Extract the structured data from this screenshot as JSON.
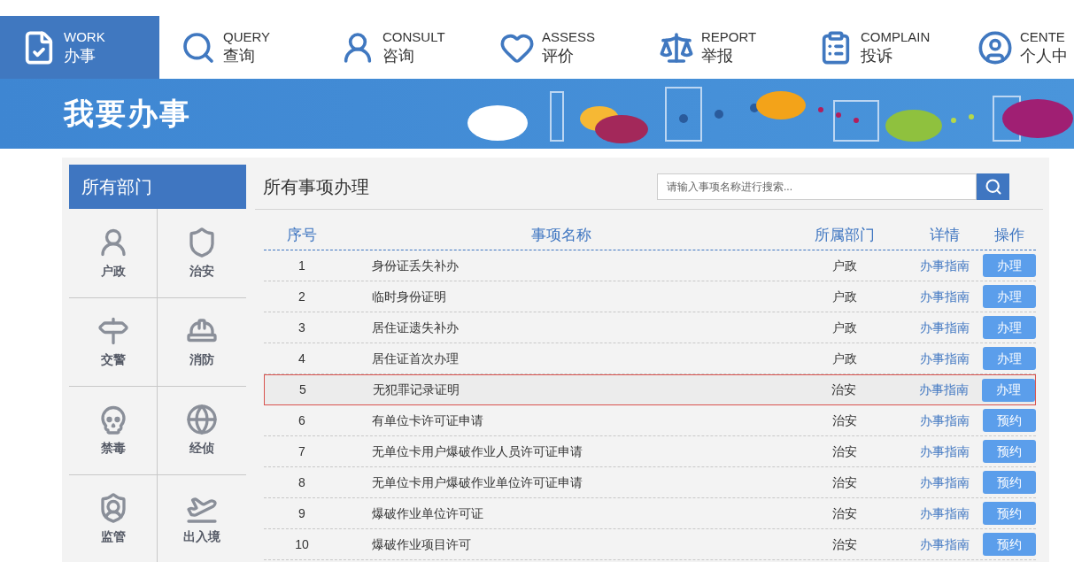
{
  "nav": [
    {
      "en": "WORK",
      "zh": "办事",
      "selected": true
    },
    {
      "en": "QUERY",
      "zh": "查询",
      "selected": false
    },
    {
      "en": "CONSULT",
      "zh": "咨询",
      "selected": false
    },
    {
      "en": "ASSESS",
      "zh": "评价",
      "selected": false
    },
    {
      "en": "REPORT",
      "zh": "举报",
      "selected": false
    },
    {
      "en": "COMPLAIN",
      "zh": "投诉",
      "selected": false
    },
    {
      "en": "CENTE",
      "zh": "个人中",
      "selected": false
    }
  ],
  "banner": {
    "title": "我要办事"
  },
  "sidebar": {
    "title": "所有部门",
    "items": [
      {
        "label": "户政"
      },
      {
        "label": "治安"
      },
      {
        "label": "交警"
      },
      {
        "label": "消防"
      },
      {
        "label": "禁毒"
      },
      {
        "label": "经侦"
      },
      {
        "label": "监管"
      },
      {
        "label": "出入境"
      }
    ]
  },
  "main": {
    "title": "所有事项办理",
    "search": {
      "placeholder": "请输入事项名称进行搜索..."
    },
    "columns": [
      "序号",
      "事项名称",
      "所属部门",
      "详情",
      "操作"
    ],
    "rows": [
      {
        "no": "1",
        "name": "身份证丢失补办",
        "dept": "户政",
        "detail": "办事指南",
        "action": "办理",
        "selected": false
      },
      {
        "no": "2",
        "name": "临时身份证明",
        "dept": "户政",
        "detail": "办事指南",
        "action": "办理",
        "selected": false
      },
      {
        "no": "3",
        "name": "居住证遗失补办",
        "dept": "户政",
        "detail": "办事指南",
        "action": "办理",
        "selected": false
      },
      {
        "no": "4",
        "name": "居住证首次办理",
        "dept": "户政",
        "detail": "办事指南",
        "action": "办理",
        "selected": false
      },
      {
        "no": "5",
        "name": "无犯罪记录证明",
        "dept": "治安",
        "detail": "办事指南",
        "action": "办理",
        "selected": true
      },
      {
        "no": "6",
        "name": "有单位卡许可证申请",
        "dept": "治安",
        "detail": "办事指南",
        "action": "预约",
        "selected": false
      },
      {
        "no": "7",
        "name": "无单位卡用户爆破作业人员许可证申请",
        "dept": "治安",
        "detail": "办事指南",
        "action": "预约",
        "selected": false
      },
      {
        "no": "8",
        "name": "无单位卡用户爆破作业单位许可证申请",
        "dept": "治安",
        "detail": "办事指南",
        "action": "预约",
        "selected": false
      },
      {
        "no": "9",
        "name": "爆破作业单位许可证",
        "dept": "治安",
        "detail": "办事指南",
        "action": "预约",
        "selected": false
      },
      {
        "no": "10",
        "name": "爆破作业项目许可",
        "dept": "治安",
        "detail": "办事指南",
        "action": "预约",
        "selected": false
      }
    ]
  }
}
